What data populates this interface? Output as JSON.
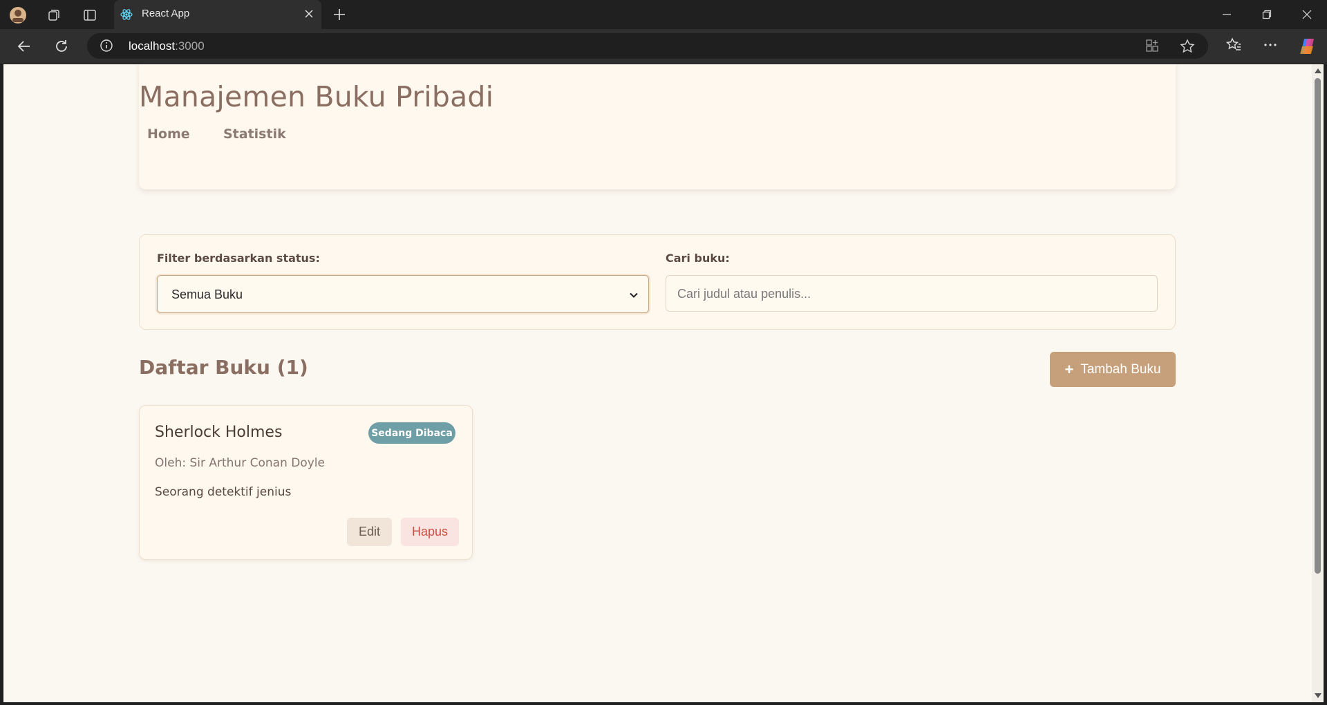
{
  "browser": {
    "tab_title": "React App",
    "url_host": "localhost",
    "url_port": ":3000",
    "icons": [
      "profile-avatar-icon",
      "workspaces-icon",
      "tab-actions-icon",
      "react-favicon-icon",
      "close-icon",
      "plus-icon",
      "minimize-icon",
      "restore-icon",
      "close-window-icon",
      "back-icon",
      "refresh-icon",
      "info-icon",
      "app-available-icon",
      "favorite-star-icon",
      "favorites-icon",
      "more-icon",
      "copilot-icon"
    ]
  },
  "header": {
    "title": "Manajemen Buku Pribadi",
    "nav": [
      {
        "label": "Home"
      },
      {
        "label": "Statistik"
      }
    ]
  },
  "filter": {
    "status_label": "Filter berdasarkan status:",
    "status_value": "Semua Buku",
    "search_label": "Cari buku:",
    "search_placeholder": "Cari judul atau penulis..."
  },
  "list": {
    "title": "Daftar Buku (1)",
    "add_button_label": "Tambah Buku",
    "add_button_icon": "+"
  },
  "books": [
    {
      "title": "Sherlock Holmes",
      "status": "Sedang Dibaca",
      "author": "Oleh: Sir Arthur Conan Doyle",
      "description": "Seorang detektif jenius",
      "edit_label": "Edit",
      "delete_label": "Hapus"
    }
  ],
  "colors": {
    "accent": "#c6a07b",
    "title": "#8b6e62",
    "status_badge": "#6f9fa6",
    "delete": "#c84f44"
  }
}
